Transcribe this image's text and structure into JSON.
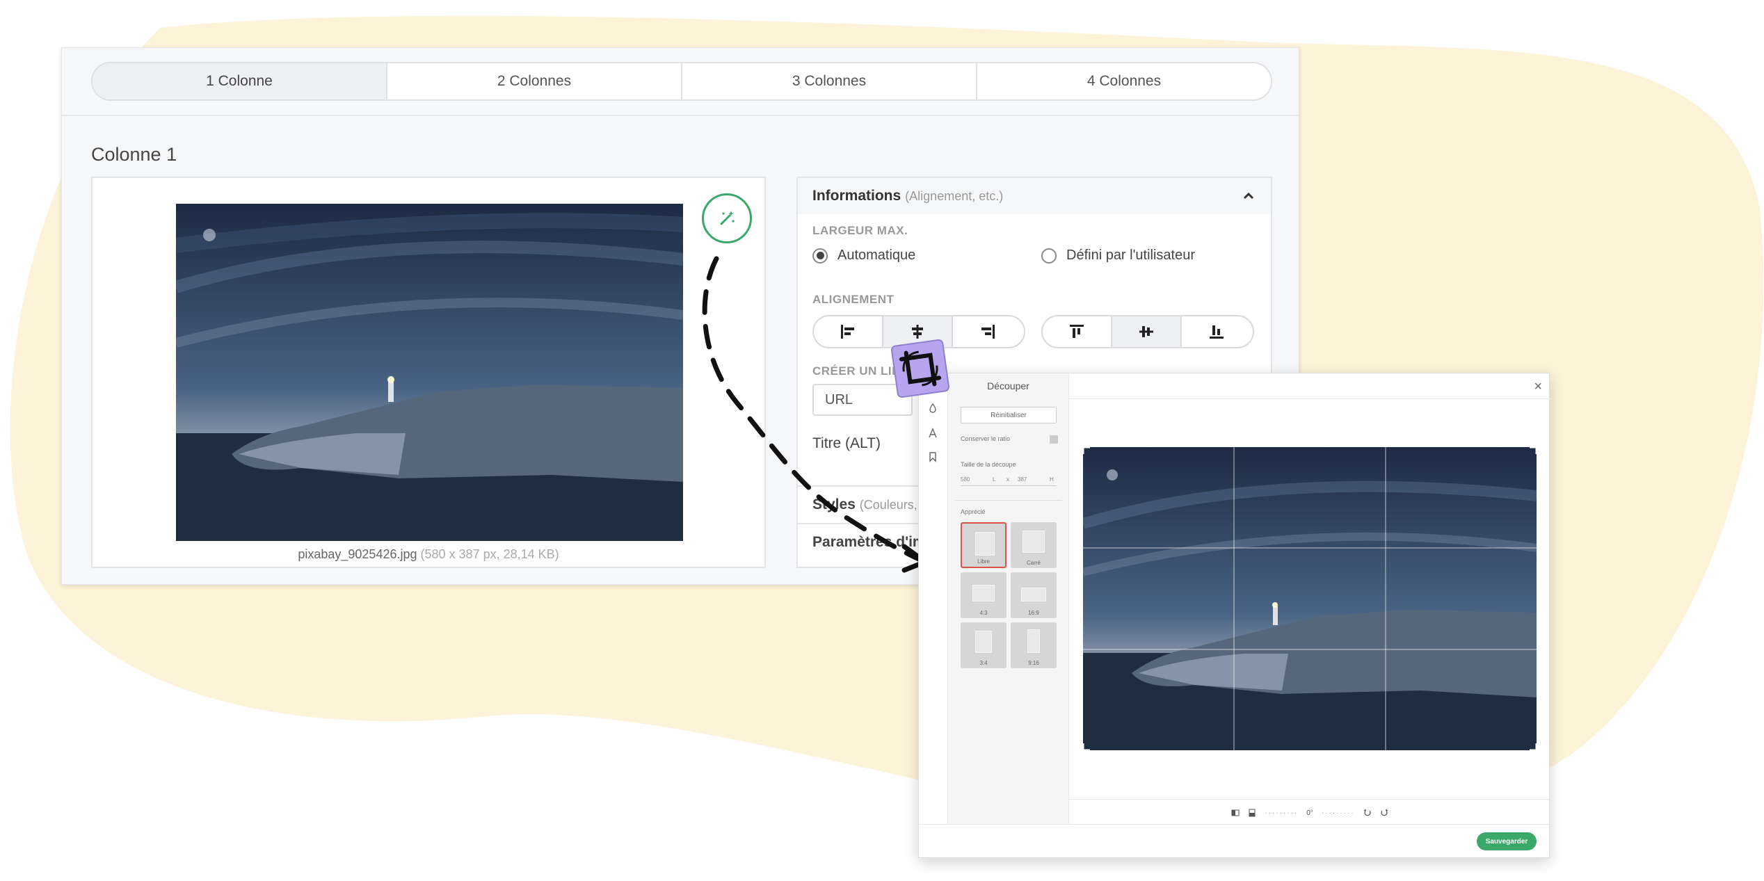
{
  "tabs": [
    {
      "label": "1 Colonne"
    },
    {
      "label": "2 Colonnes"
    },
    {
      "label": "3 Colonnes"
    },
    {
      "label": "4 Colonnes"
    }
  ],
  "column_title": "Colonne 1",
  "image_caption": {
    "filename": "pixabay_9025426.jpg",
    "details": "(580 x 387 px, 28,14 KB)"
  },
  "info_panel": {
    "title": "Informations",
    "subtitle": "(Alignement, etc.)",
    "max_width_label": "LARGEUR MAX.",
    "radio_auto": "Automatique",
    "radio_user": "Défini par l'utilisateur",
    "alignment_label": "ALIGNEMENT",
    "link_label": "CRÉER UN LIEN",
    "url_placeholder": "URL",
    "alt_label": "Titre (ALT)",
    "styles_title": "Styles",
    "styles_sub": "(Couleurs, c",
    "params_title": "Paramètres d'im"
  },
  "crop_dialog": {
    "title": "Découper",
    "reset_label": "Réinitialiser",
    "keep_ratio_label": "Conserver le ratio",
    "crop_size_label": "Taille de la découpe",
    "width_value": "580",
    "width_unit": "L",
    "times": "x",
    "height_value": "387",
    "height_unit": "H",
    "presets_label": "Apprécié",
    "presets": [
      "Libre",
      "Carré",
      "4:3",
      "16:9",
      "3:4",
      "9:16"
    ],
    "rotation": "0°",
    "save_label": "Sauvegarder",
    "close_glyph": "×"
  },
  "colors": {
    "accent_green": "#3aa86b",
    "blob": "#fcf3d9",
    "sticker": "#b7a6ef"
  }
}
